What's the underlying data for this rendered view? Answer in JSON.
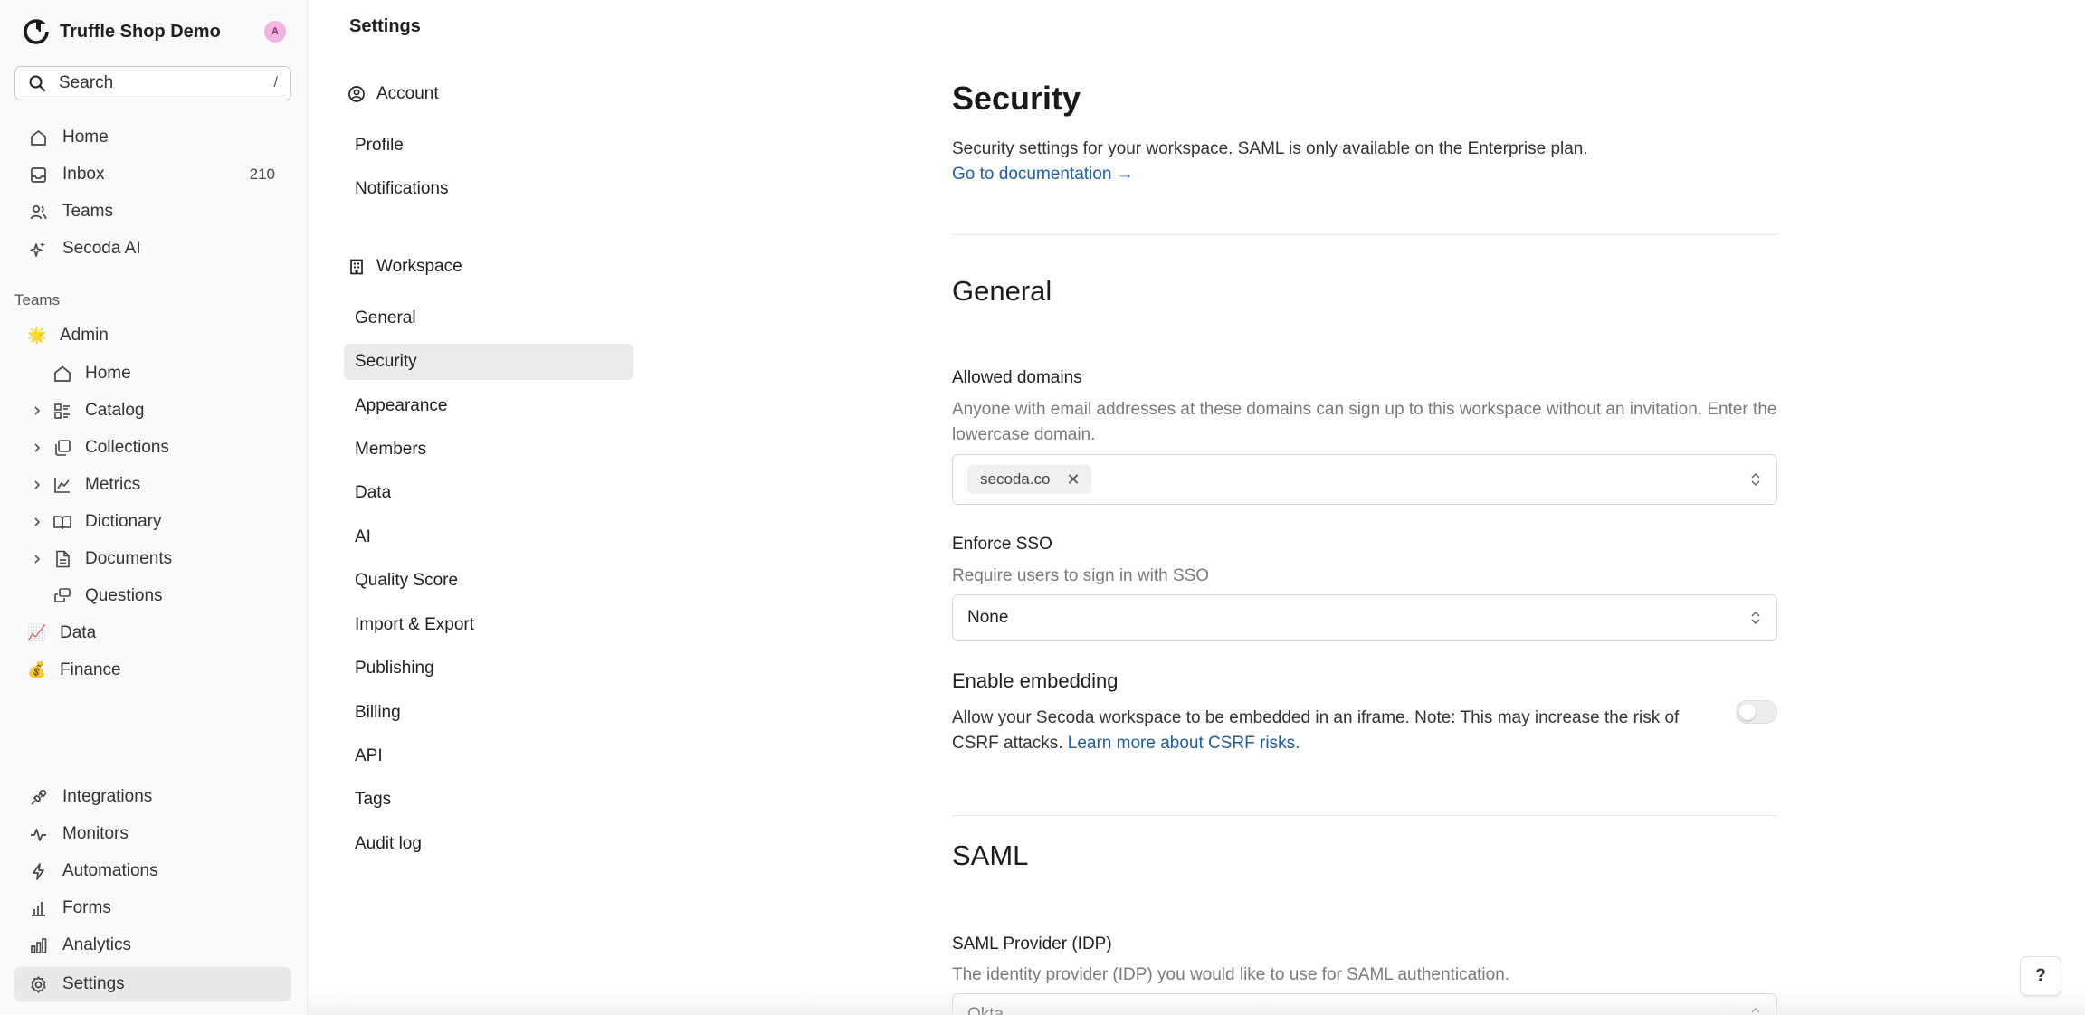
{
  "workspace": {
    "name": "Truffle Shop Demo",
    "avatar_initial": "A"
  },
  "search": {
    "label": "Search",
    "shortcut": "/"
  },
  "sidebar": {
    "top_items": [
      {
        "label": "Home",
        "icon": "home-icon"
      },
      {
        "label": "Inbox",
        "icon": "inbox-icon",
        "count": "210"
      },
      {
        "label": "Teams",
        "icon": "users-icon"
      },
      {
        "label": "Secoda AI",
        "icon": "sparkles-icon"
      }
    ],
    "teams_label": "Teams",
    "teams": [
      {
        "label": "Admin",
        "emoji": "🌟"
      },
      {
        "label": "Data",
        "emoji": "📈"
      },
      {
        "label": "Finance",
        "emoji": "💰"
      }
    ],
    "admin_children": [
      {
        "label": "Home",
        "icon": "home-icon"
      },
      {
        "label": "Catalog",
        "icon": "catalog-icon"
      },
      {
        "label": "Collections",
        "icon": "collections-icon"
      },
      {
        "label": "Metrics",
        "icon": "chart-icon"
      },
      {
        "label": "Dictionary",
        "icon": "book-icon"
      },
      {
        "label": "Documents",
        "icon": "document-icon"
      },
      {
        "label": "Questions",
        "icon": "questions-icon"
      }
    ],
    "bottom_items": [
      {
        "label": "Integrations",
        "icon": "plug-icon"
      },
      {
        "label": "Monitors",
        "icon": "pulse-icon"
      },
      {
        "label": "Automations",
        "icon": "bolt-icon"
      },
      {
        "label": "Forms",
        "icon": "forms-icon"
      },
      {
        "label": "Analytics",
        "icon": "bar-chart-icon"
      },
      {
        "label": "Settings",
        "icon": "gear-icon"
      }
    ]
  },
  "settings_nav": {
    "title": "Settings",
    "account_label": "Account",
    "account_items": [
      "Profile",
      "Notifications"
    ],
    "workspace_label": "Workspace",
    "workspace_items": [
      "General",
      "Security",
      "Appearance",
      "Members",
      "Data",
      "AI",
      "Quality Score",
      "Import & Export",
      "Publishing",
      "Billing",
      "API",
      "Tags",
      "Audit log"
    ]
  },
  "main": {
    "title": "Security",
    "description": "Security settings for your workspace. SAML is only available on the Enterprise plan.",
    "doc_link": "Go to documentation →",
    "general_heading": "General",
    "allowed_domains": {
      "label": "Allowed domains",
      "help": "Anyone with email addresses at these domains can sign up to this workspace without an invitation. Enter the lowercase domain.",
      "chip": "secoda.co"
    },
    "enforce_sso": {
      "label": "Enforce SSO",
      "help": "Require users to sign in with SSO",
      "value": "None"
    },
    "embedding": {
      "label": "Enable embedding",
      "help": "Allow your Secoda workspace to be embedded in an iframe. Note: This may increase the risk of CSRF attacks.",
      "link": "Learn more about CSRF risks.",
      "enabled": false
    },
    "saml_heading": "SAML",
    "saml_provider": {
      "label": "SAML Provider (IDP)",
      "help": "The identity provider (IDP) you would like to use for SAML authentication.",
      "value": "Okta"
    }
  },
  "help_button": "?",
  "colors": {
    "link": "#1f5ea8",
    "active_bg": "#ebebeb",
    "avatar_bg": "#f2b3e0"
  }
}
